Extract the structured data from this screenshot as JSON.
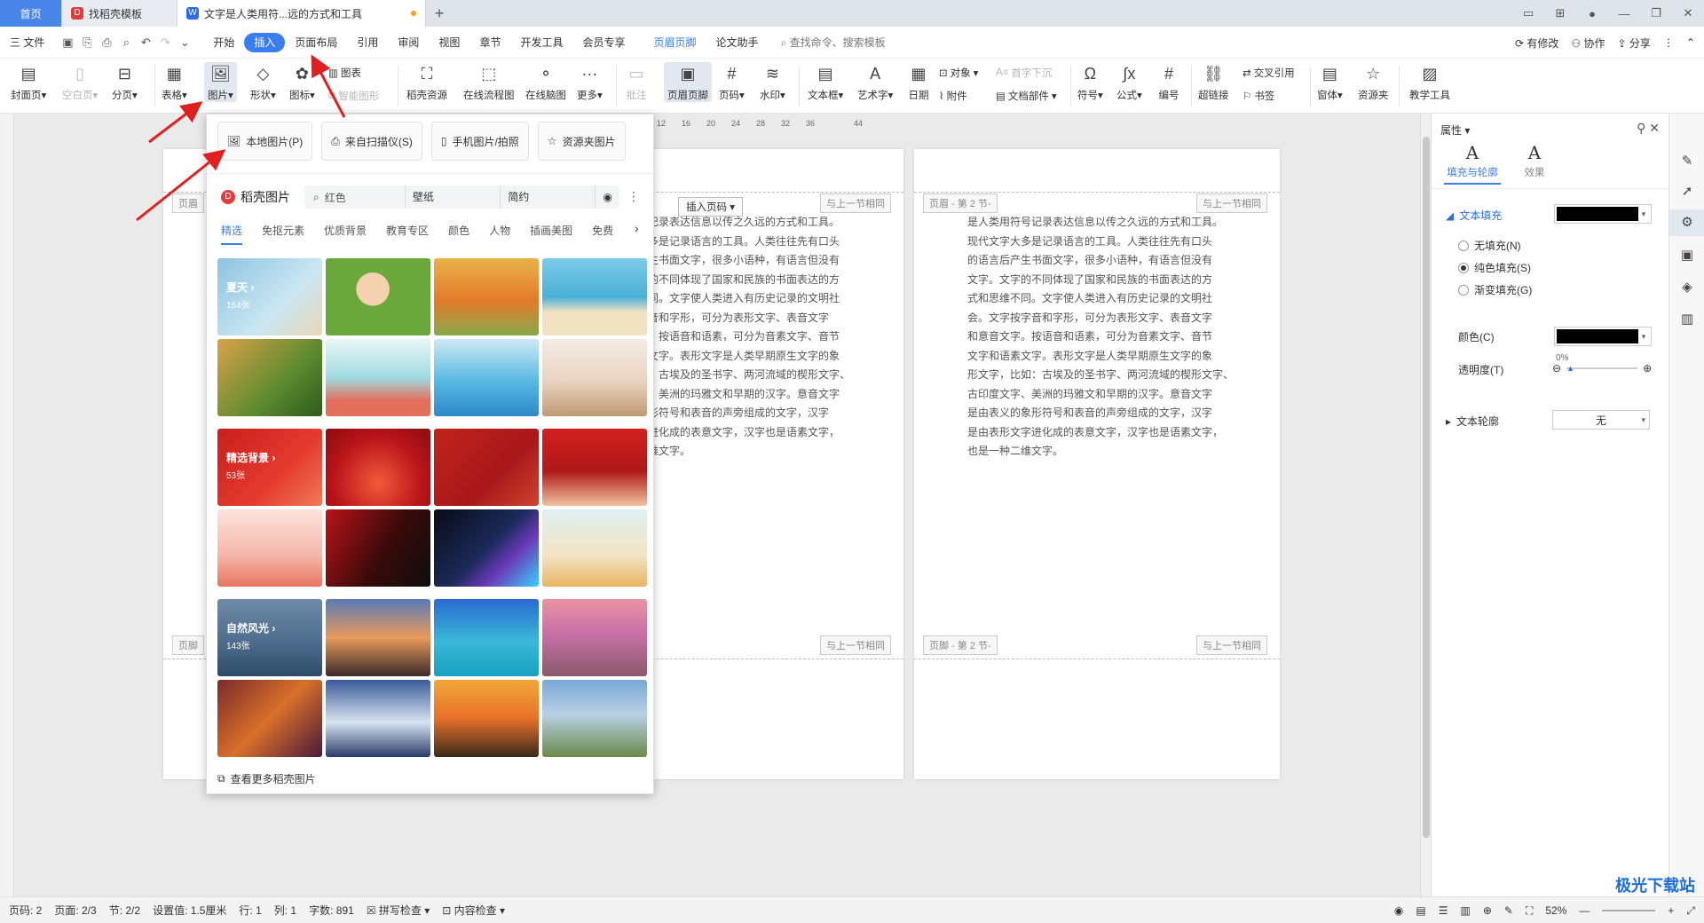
{
  "tabs": [
    {
      "label": "首页"
    },
    {
      "label": "找稻壳模板"
    },
    {
      "label": "文字是人类用符...远的方式和工具"
    }
  ],
  "menu": {
    "file": "三 文件",
    "items": [
      "开始",
      "插入",
      "页面布局",
      "引用",
      "审阅",
      "视图",
      "章节",
      "开发工具",
      "会员专享",
      "页眉页脚",
      "论文助手"
    ],
    "search": "查找命令、搜索模板",
    "right": [
      "有修改",
      "协作",
      "分享"
    ]
  },
  "ribbon": {
    "cover": "封面页",
    "blank": "空白页",
    "break": "分页",
    "table": "表格",
    "picture": "图片",
    "shape": "形状",
    "icon": "图标",
    "chart": "图表",
    "smart": "智能图形",
    "docer": "稻壳资源",
    "flow": "在线流程图",
    "mind": "在线脑图",
    "more": "更多",
    "comment": "批注",
    "headfoot": "页眉页脚",
    "pagenum": "页码",
    "watermark": "水印",
    "textbox": "文本框",
    "wordart": "艺术字",
    "date": "日期",
    "object": "对象",
    "attach": "附件",
    "dropcap": "首字下沉",
    "docpart": "文档部件",
    "symbol": "符号",
    "formula": "公式",
    "number": "编号",
    "hyperlink": "超链接",
    "crossref": "交叉引用",
    "bookmark": "书签",
    "window": "窗体",
    "resource": "资源夹",
    "teach": "教学工具"
  },
  "popup": {
    "local": "本地图片(P)",
    "scan": "来自扫描仪(S)",
    "phone": "手机图片/拍照",
    "folder": "资源夹图片",
    "docer": "稻壳图片",
    "search_value": "红色",
    "tag1": "壁纸",
    "tag2": "简约",
    "cats": [
      "精选",
      "免抠元素",
      "优质背景",
      "教育专区",
      "颜色",
      "人物",
      "插画美图",
      "免费"
    ],
    "groups": [
      {
        "title": "夏天",
        "count": "164张"
      },
      {
        "title": "精选背景",
        "count": "53张"
      },
      {
        "title": "自然风光",
        "count": "143张"
      }
    ],
    "see_more": "查看更多稻壳图片"
  },
  "document": {
    "insert_pagenum": "插入页码",
    "same_prev": "与上一节相同",
    "header_left": "页眉",
    "header_sec2": "页眉 - 第 2 节-",
    "footer_left": "页脚",
    "footer_sec2": "页脚 - 第 2 节-",
    "ruler": [
      "12",
      "16",
      "20",
      "24",
      "28",
      "32",
      "36",
      "44"
    ],
    "page1_lines": [
      "记录表达信息以传之久远的方式和工具。",
      "多是记录语言的工具。人类往往先有口头",
      "生书面文字，很多小语种，有语言但没有",
      "的不同体现了国家和民族的书面表达的方",
      "同。文字使人类进入有历史记录的文明社",
      "音和字形，可分为表形文字、表音文字",
      "。按语音和语素，可分为音素文字、音节",
      "文字。表形文字是人类早期原生文字的象",
      "：古埃及的圣书字、两河流域的楔形文字、",
      "、美洲的玛雅文和早期的汉字。意音文字",
      "形符号和表音的声旁组成的文字，汉字",
      "进化成的表意文字，汉字也是语素文字，",
      "维文字。"
    ],
    "page2_lines": [
      "是人类用符号记录表达信息以传之久远的方式和工具。",
      "现代文字大多是记录语言的工具。人类往往先有口头",
      "的语言后产生书面文字，很多小语种，有语言但没有",
      "文字。文字的不同体现了国家和民族的书面表达的方",
      "式和思维不同。文字使人类进入有历史记录的文明社",
      "会。文字按字音和字形，可分为表形文字、表音文字",
      "和意音文字。按语音和语素，可分为音素文字、音节",
      "文字和语素文字。表形文字是人类早期原生文字的象",
      "形文字，比如：古埃及的圣书字、两河流域的楔形文字、",
      "古印度文字、美洲的玛雅文和早期的汉字。意音文字",
      "是由表义的象形符号和表音的声旁组成的文字，汉字",
      "是由表形文字进化成的表意文字，汉字也是语素文字，",
      "也是一种二维文字。"
    ]
  },
  "properties": {
    "title": "属性",
    "tab_fill": "填充与轮廓",
    "tab_effect": "效果",
    "text_fill": "文本填充",
    "no_fill": "无填充(N)",
    "solid_fill": "纯色填充(S)",
    "gradient_fill": "渐变填充(G)",
    "color": "颜色(C)",
    "transparency": "透明度(T)",
    "transparency_value": "0%",
    "outline": "文本轮廓",
    "outline_value": "无",
    "fill_color": "#000000"
  },
  "status": {
    "page": "页码: 2",
    "pages": "页面: 2/3",
    "section": "节: 2/2",
    "setting": "设置值: 1.5厘米",
    "row": "行: 1",
    "col": "列: 1",
    "words": "字数: 891",
    "spell": "拼写检查",
    "content": "内容检查",
    "zoom": "52%"
  },
  "watermark": "极光下载站",
  "colors": {
    "accent": "#3a7df0",
    "arrow": "#e02020"
  }
}
